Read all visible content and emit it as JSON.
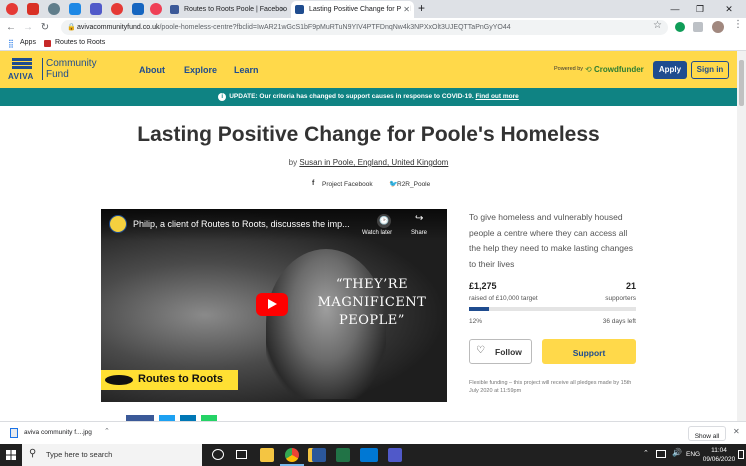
{
  "browser": {
    "tabs": [
      {
        "label": "Routes to Roots Poole | Faceboo",
        "color": "#3b5998"
      },
      {
        "label": "Lasting Positive Change for Pool",
        "color": "#1f4c8f"
      }
    ],
    "url_host": "avivacommunityfund.co.uk",
    "url_path": "/poole-homeless-centre?fbclid=IwAR21wGcS1bF9pMuRTuN9YIV4PTFDnqNw4k3NPXxOlt3UJEQTTaPnGyYO44",
    "bookmarks": [
      "Apps",
      "Routes to Roots"
    ]
  },
  "site": {
    "logo_brand": "AVIVA",
    "logo_line1": "Community",
    "logo_line2": "Fund",
    "nav": [
      "About",
      "Explore",
      "Learn"
    ],
    "powered_by": "Powered by",
    "crowdfunder": "Crowdfunder",
    "apply_label": "Apply",
    "signin_label": "Sign in",
    "banner_text": "UPDATE: Our criteria has changed to support causes in response to COVID-19.",
    "banner_link": "Find out more"
  },
  "project": {
    "title": "Lasting Positive Change for Poole's Homeless",
    "by_prefix": "by",
    "author": "Susan in Poole, England, United Kingdom",
    "facebook_link": "Project Facebook",
    "twitter_handle": "R2R_Poole",
    "description": "To give homeless and vulnerably housed people a centre where they can access all the help they need to make lasting changes to their lives",
    "raised": "£1,275",
    "raised_of": "raised of £10,000 target",
    "supporters_count": "21",
    "supporters_label": "supporters",
    "percent_text": "12%",
    "progress_fraction": 0.12,
    "days_left": "36 days left",
    "follow_label": "Follow",
    "support_label": "Support",
    "footnote": "Flexible funding – this project will receive all pledges made by 15th July 2020 at 11:59pm"
  },
  "video": {
    "title": "Philip, a client of Routes to Roots, discusses the imp...",
    "watch_later": "Watch later",
    "share": "Share",
    "quote_line1": "“THEY’RE",
    "quote_line2": "MAGNIFICENT",
    "quote_line3": "PEOPLE”",
    "caption": "Routes to Roots"
  },
  "downloads": {
    "file_name": "aviva community f....jpg",
    "show_all": "Show all"
  },
  "taskbar": {
    "search_placeholder": "Type here to search",
    "lang": "ENG",
    "time": "11:04",
    "date": "09/06/2020"
  },
  "colors": {
    "header_yellow": "#ffd94a",
    "banner_teal": "#0f8383",
    "nav_blue": "#1f4c8f",
    "support_yellow": "#ffd94a",
    "progress_blue": "#1f4c8f"
  }
}
